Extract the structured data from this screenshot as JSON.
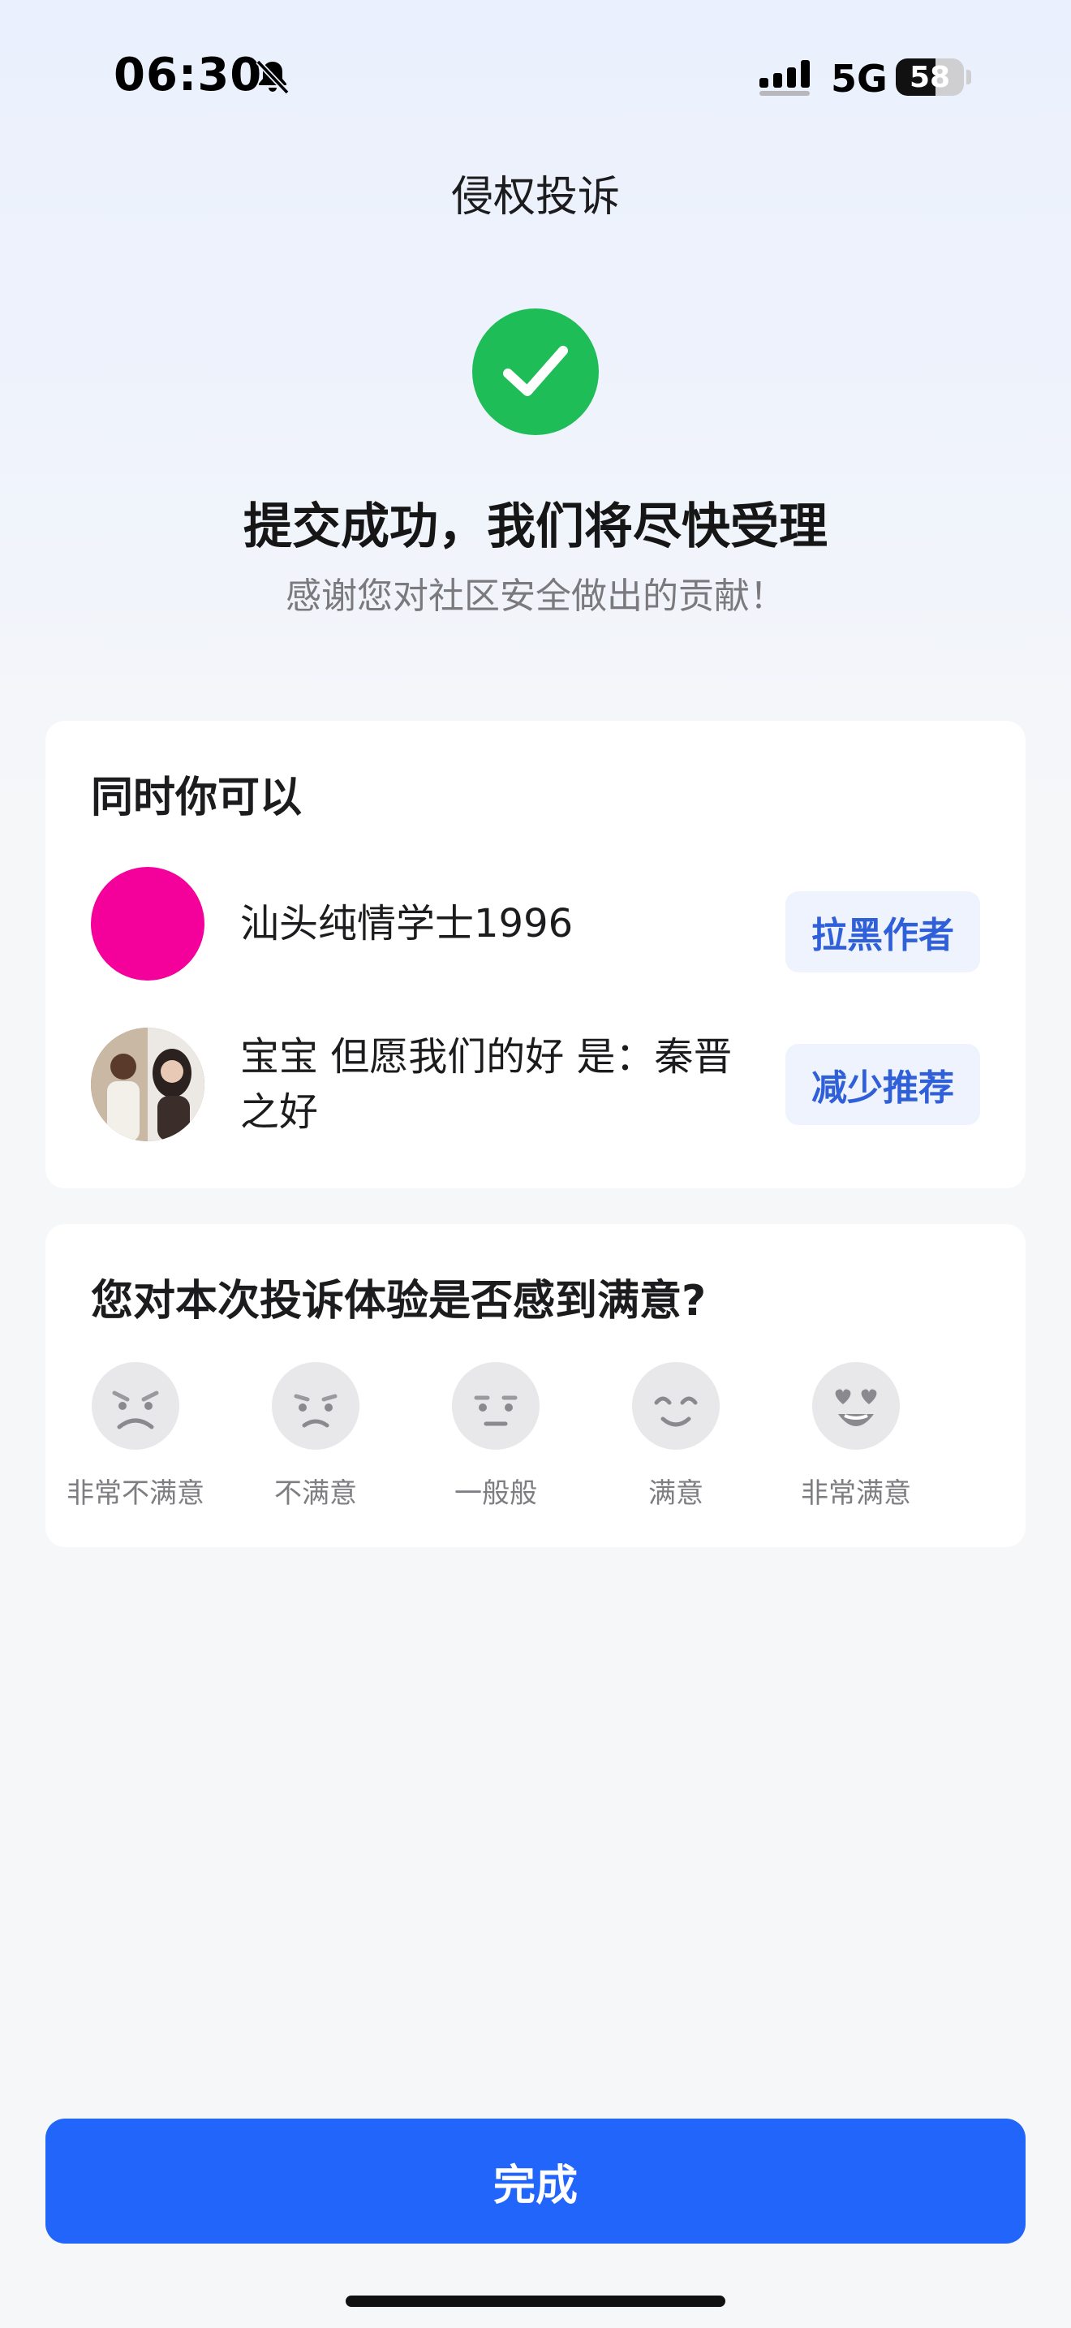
{
  "status_bar": {
    "time": "06:30",
    "network": "5G",
    "battery": "58",
    "battery_level": 0.58
  },
  "header": {
    "title": "侵权投诉"
  },
  "result": {
    "title": "提交成功，我们将尽快受理",
    "subtitle": "感谢您对社区安全做出的贡献！",
    "icon": "check-circle-icon",
    "icon_color": "#1fbd57"
  },
  "actions": {
    "heading": "同时你可以",
    "rows": [
      {
        "name": "汕头纯情学士1996",
        "button_label": "拉黑作者",
        "avatar_color": "#f4009a"
      },
      {
        "name": "宝宝  但愿我们的好  是：秦晋之好",
        "button_label": "减少推荐",
        "avatar_color": "#8b7564"
      }
    ]
  },
  "survey": {
    "question": "您对本次投诉体验是否感到满意?",
    "options": [
      {
        "label": "非常不满意",
        "icon": "very-dissatisfied-face-icon"
      },
      {
        "label": "不满意",
        "icon": "dissatisfied-face-icon"
      },
      {
        "label": "一般般",
        "icon": "neutral-face-icon"
      },
      {
        "label": "满意",
        "icon": "satisfied-face-icon"
      },
      {
        "label": "非常满意",
        "icon": "very-satisfied-face-icon"
      }
    ]
  },
  "footer": {
    "done_label": "完成"
  },
  "colors": {
    "primary": "#2165fb",
    "link": "#2f5fd9",
    "success": "#1fbd57"
  }
}
